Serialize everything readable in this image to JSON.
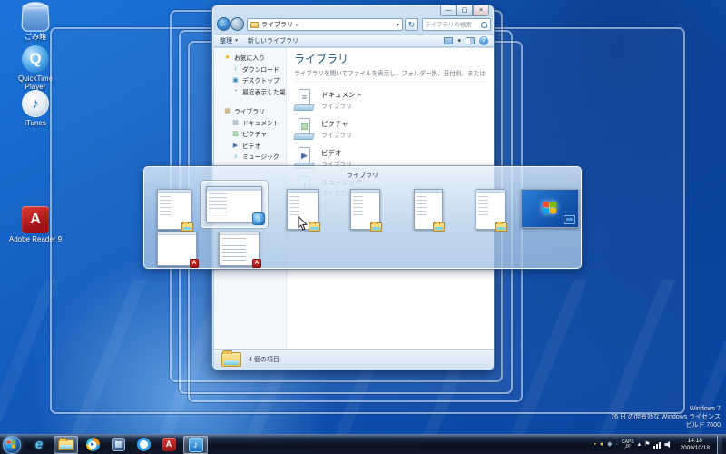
{
  "desktop": {
    "icons": [
      {
        "label": "ごみ箱"
      },
      {
        "label": "QuickTime Player"
      },
      {
        "label": "iTunes"
      },
      {
        "label": "Adobe Reader 9"
      }
    ],
    "watermark": {
      "line1": "Windows 7",
      "line2": "76 日 の間有効な Windows ライセンス",
      "line3": "ビルド 7600"
    }
  },
  "explorer": {
    "caption": {
      "minimize": "—",
      "maximize": "▢",
      "close": "×"
    },
    "address": {
      "breadcrumb_root": "ライブラリ",
      "search_placeholder": "ライブラリの検索"
    },
    "toolbar": {
      "organize": "整理",
      "new_library": "新しいライブラリ",
      "help": "?"
    },
    "sidebar": {
      "favorites": {
        "label": "お気に入り",
        "items": [
          "ダウンロード",
          "デスクトップ",
          "最近表示した場所"
        ]
      },
      "libraries": {
        "label": "ライブラリ",
        "items": [
          "ドキュメント",
          "ピクチャ",
          "ビデオ",
          "ミュージック"
        ]
      }
    },
    "main": {
      "title": "ライブラリ",
      "subtitle": "ライブラリを開いてファイルを表示し、フォルダー別、日付別、またはその他...",
      "items": [
        {
          "name": "ドキュメント",
          "sub": "ライブラリ"
        },
        {
          "name": "ピクチャ",
          "sub": "ライブラリ"
        },
        {
          "name": "ビデオ",
          "sub": "ライブラリ"
        },
        {
          "name": "ミュージック",
          "sub": "ライブラリ"
        }
      ]
    },
    "statusbar": {
      "items_count": "4 個の項目"
    }
  },
  "peek": {
    "title": "ライブラリ"
  },
  "taskbar": {
    "ime": {
      "line1": "CAPS",
      "line2": "JP"
    },
    "clock": {
      "time": "14:18",
      "date": "2009/10/18"
    }
  },
  "glyphs": {
    "back": "←",
    "forward": "→",
    "crumb_sep": "▸",
    "caret": "▾",
    "refresh": "↻",
    "organize_caret": "▼",
    "star": "★",
    "download": "↓",
    "desktop_item": "▣",
    "recent": "◔",
    "lib_header": "▦",
    "doc": "▤",
    "pict": "▨",
    "video": "▶",
    "music": "♪",
    "doc_page": "≡",
    "tray_up": "▴",
    "flag": "⚑",
    "qt_q": "Q",
    "adobe_a": "A",
    "ie_e": "e",
    "bin_q": "",
    "itunes_note": "♪"
  }
}
